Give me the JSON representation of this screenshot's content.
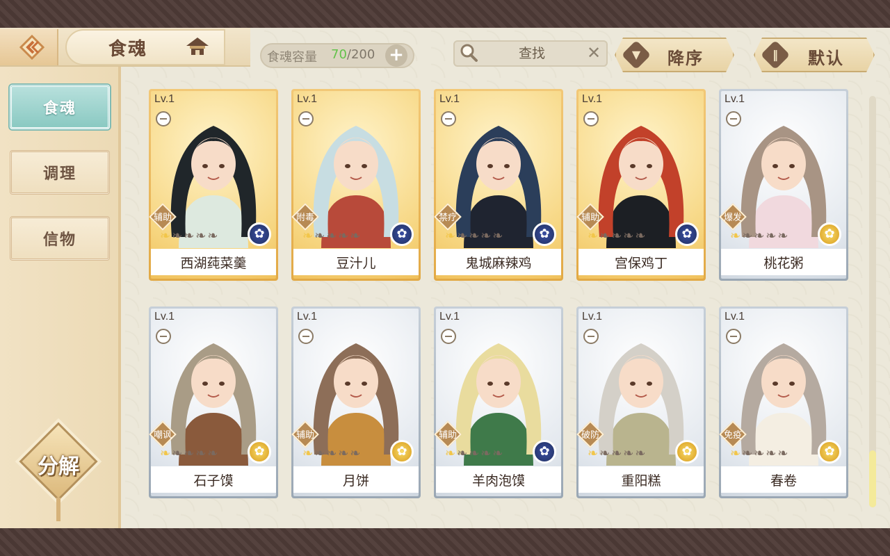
{
  "header": {
    "title": "食魂",
    "capacity_label": "食魂容量",
    "capacity_current": "70",
    "capacity_separator_total": "/200",
    "add_label": "+"
  },
  "search": {
    "placeholder": "查找",
    "clear_label": "✕"
  },
  "sort": {
    "order_label": "降序",
    "mode_label": "默认"
  },
  "sidebar": {
    "tabs": [
      {
        "label": "食魂",
        "active": true
      },
      {
        "label": "调理",
        "active": false
      },
      {
        "label": "信物",
        "active": false
      }
    ],
    "decompose_label": "分解"
  },
  "cards": [
    {
      "level": "Lv.1",
      "role": "辅助",
      "name": "西湖莼菜羹",
      "rarity": "gold",
      "element": "blue",
      "stars": 1,
      "hair": "#20262a",
      "cloth": "#dde9df"
    },
    {
      "level": "Lv.1",
      "role": "附毒",
      "name": "豆汁儿",
      "rarity": "gold",
      "element": "blue",
      "stars": 1,
      "hair": "#c7dde2",
      "cloth": "#b84a3a"
    },
    {
      "level": "Lv.1",
      "role": "禁疗",
      "name": "鬼城麻辣鸡",
      "rarity": "gold",
      "element": "blue",
      "stars": 1,
      "hair": "#2b3e5a",
      "cloth": "#1f2430"
    },
    {
      "level": "Lv.1",
      "role": "辅助",
      "name": "宫保鸡丁",
      "rarity": "gold",
      "element": "blue",
      "stars": 1,
      "hair": "#c2412a",
      "cloth": "#1c1f24"
    },
    {
      "level": "Lv.1",
      "role": "爆发",
      "name": "桃花粥",
      "rarity": "silver",
      "element": "gold",
      "stars": 1,
      "hair": "#a89484",
      "cloth": "#f1d9de"
    },
    {
      "level": "Lv.1",
      "role": "嘲讽",
      "name": "石子馍",
      "rarity": "silver",
      "element": "gold",
      "stars": 1,
      "hair": "#a99c86",
      "cloth": "#8a5a3c"
    },
    {
      "level": "Lv.1",
      "role": "辅助",
      "name": "月饼",
      "rarity": "silver",
      "element": "gold",
      "stars": 1,
      "hair": "#8d6e58",
      "cloth": "#c88e3e"
    },
    {
      "level": "Lv.1",
      "role": "辅助",
      "name": "羊肉泡馍",
      "rarity": "silver",
      "element": "blue",
      "stars": 1,
      "hair": "#e9dc9e",
      "cloth": "#3f7a4a"
    },
    {
      "level": "Lv.1",
      "role": "破防",
      "name": "重阳糕",
      "rarity": "silver",
      "element": "gold",
      "stars": 1,
      "hair": "#d4d0c8",
      "cloth": "#b9b48e"
    },
    {
      "level": "Lv.1",
      "role": "免疫",
      "name": "春卷",
      "rarity": "silver",
      "element": "gold",
      "stars": 1,
      "hair": "#b5aaa0",
      "cloth": "#f4eee2"
    }
  ],
  "star_total": 5,
  "icons": {
    "back": "double-chevron-left-icon",
    "house": "pagoda-icon",
    "search": "magnifier-icon",
    "sort_order": "triangle-down-icon",
    "sort_mode": "bars-icon",
    "element_blue": "blue-flower-icon",
    "element_gold": "gold-flower-icon"
  },
  "colors": {
    "accent_teal": "#8ac9c2",
    "capacity_green": "#63c24b",
    "card_gold": "#e2a945",
    "card_silver": "#9aa7b4"
  }
}
